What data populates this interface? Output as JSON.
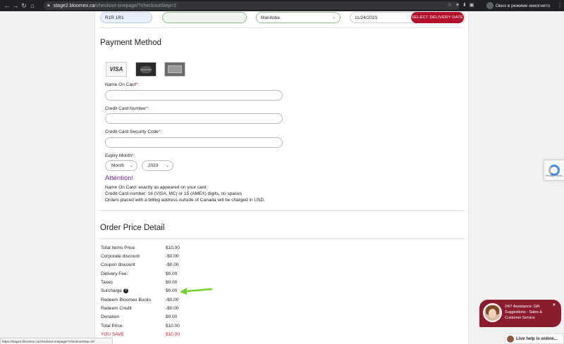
{
  "browser": {
    "url_host": "stage2.bloomex.ca",
    "url_path": "/checkout-onepage/?checkoutStep=2",
    "incognito_label": "Окно в режиме инкогнито",
    "status_url": "https://stage2.bloomex.ca/checkout-onepage/?checkoutStep=2#"
  },
  "delivery": {
    "postal_code": "R1R 1R1",
    "province": "Manitoba",
    "date": "11/24/2023",
    "select_date_label": "SELECT DELIVERY DATE"
  },
  "payment": {
    "title": "Payment Method",
    "card_logos": [
      "VISA",
      "MasterCard"
    ],
    "fields": {
      "name_label": "Name On Card",
      "number_label": "Credit Card Number",
      "code_label": "Credit Card Security Code",
      "expiry_label": "Expiry Month",
      "required_mark": "*",
      "colon": ":"
    },
    "expiry": {
      "month": "Month",
      "year": "2023"
    },
    "attention_title": "Attention!",
    "notes": [
      "Name On Card: exactly as appeared on your card",
      "Credit Card number: 16 (VISA, MC) or 15 (AMEX) digits, no spaces",
      "Orders placed with a billing address outside of Canada will be charged in USD."
    ]
  },
  "price": {
    "title": "Order Price Detail",
    "rows": [
      {
        "label": "Total Items Price:",
        "value": "$10.00"
      },
      {
        "label": "Corporate discount",
        "value": "-$0.00"
      },
      {
        "label": "Coupon discount",
        "value": "-$0.00"
      },
      {
        "label": "Delivery Fee:",
        "value": "$0.00"
      },
      {
        "label": "Taxes",
        "value": "$0.00"
      },
      {
        "label": "Surcharge",
        "value": "$0.00"
      },
      {
        "label": "Redeem Bloomex Bucks",
        "value": "-$0.00"
      },
      {
        "label": "Redeem Credit",
        "value": "-$0.00"
      },
      {
        "label": "Donation",
        "value": "$0.00"
      },
      {
        "label": "Total Price:",
        "value": "$10.00"
      },
      {
        "label": "YOU SAVE",
        "value": "$10.00"
      }
    ],
    "help_icon": "question-icon"
  },
  "chat": {
    "text": "24/7 Assistance: Gift Suggestions - Sales & Customer Service",
    "live_label": "Live help is online...",
    "close": "×"
  },
  "recaptcha": {
    "privacy": "Privacy - Terms"
  },
  "colors": {
    "accent": "#b3112b",
    "chat": "#8a1c2e",
    "attention": "#6a2c8a",
    "annotation_arrow": "#6fd12a"
  }
}
